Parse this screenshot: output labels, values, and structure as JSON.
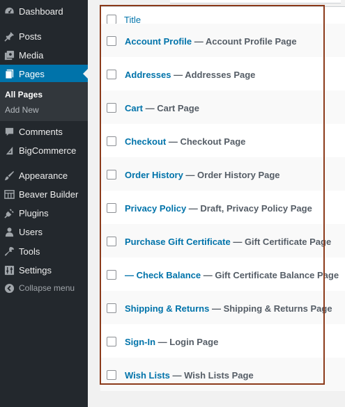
{
  "sidebar": {
    "items": [
      {
        "label": "Dashboard",
        "icon": "dashboard-icon"
      },
      {
        "label": "Posts",
        "icon": "pin-icon"
      },
      {
        "label": "Media",
        "icon": "media-icon"
      },
      {
        "label": "Pages",
        "icon": "pages-icon",
        "current": true
      },
      {
        "label": "Comments",
        "icon": "comment-icon"
      },
      {
        "label": "BigCommerce",
        "icon": "bigcommerce-icon"
      },
      {
        "label": "Appearance",
        "icon": "brush-icon"
      },
      {
        "label": "Beaver Builder",
        "icon": "grid-icon"
      },
      {
        "label": "Plugins",
        "icon": "plug-icon"
      },
      {
        "label": "Users",
        "icon": "user-icon"
      },
      {
        "label": "Tools",
        "icon": "wrench-icon"
      },
      {
        "label": "Settings",
        "icon": "settings-icon"
      }
    ],
    "submenu": [
      {
        "label": "All Pages",
        "current": true
      },
      {
        "label": "Add New"
      }
    ],
    "collapse_label": "Collapse menu"
  },
  "table": {
    "column_title": "Title",
    "rows": [
      {
        "title": "Account Profile",
        "state": " — Account Profile Page"
      },
      {
        "title": "Addresses",
        "state": " — Addresses Page"
      },
      {
        "title": "Cart",
        "state": " — Cart Page"
      },
      {
        "title": "Checkout",
        "state": " — Checkout Page"
      },
      {
        "title": "Order History",
        "state": " — Order History Page"
      },
      {
        "title": "Privacy Policy",
        "state": " — Draft, Privacy Policy Page"
      },
      {
        "title": "Purchase Gift Certificate",
        "state": " — Gift Certificate Page"
      },
      {
        "title": "— Check Balance",
        "state": " — Gift Certificate Balance Page"
      },
      {
        "title": "Shipping & Returns",
        "state": " — Shipping & Returns Page"
      },
      {
        "title": "Sign-In",
        "state": " — Login Page"
      },
      {
        "title": "Wish Lists",
        "state": " — Wish Lists Page"
      }
    ]
  },
  "colors": {
    "sidebar_bg": "#23282d",
    "accent": "#0073aa",
    "highlight": "#8b3a1a"
  }
}
